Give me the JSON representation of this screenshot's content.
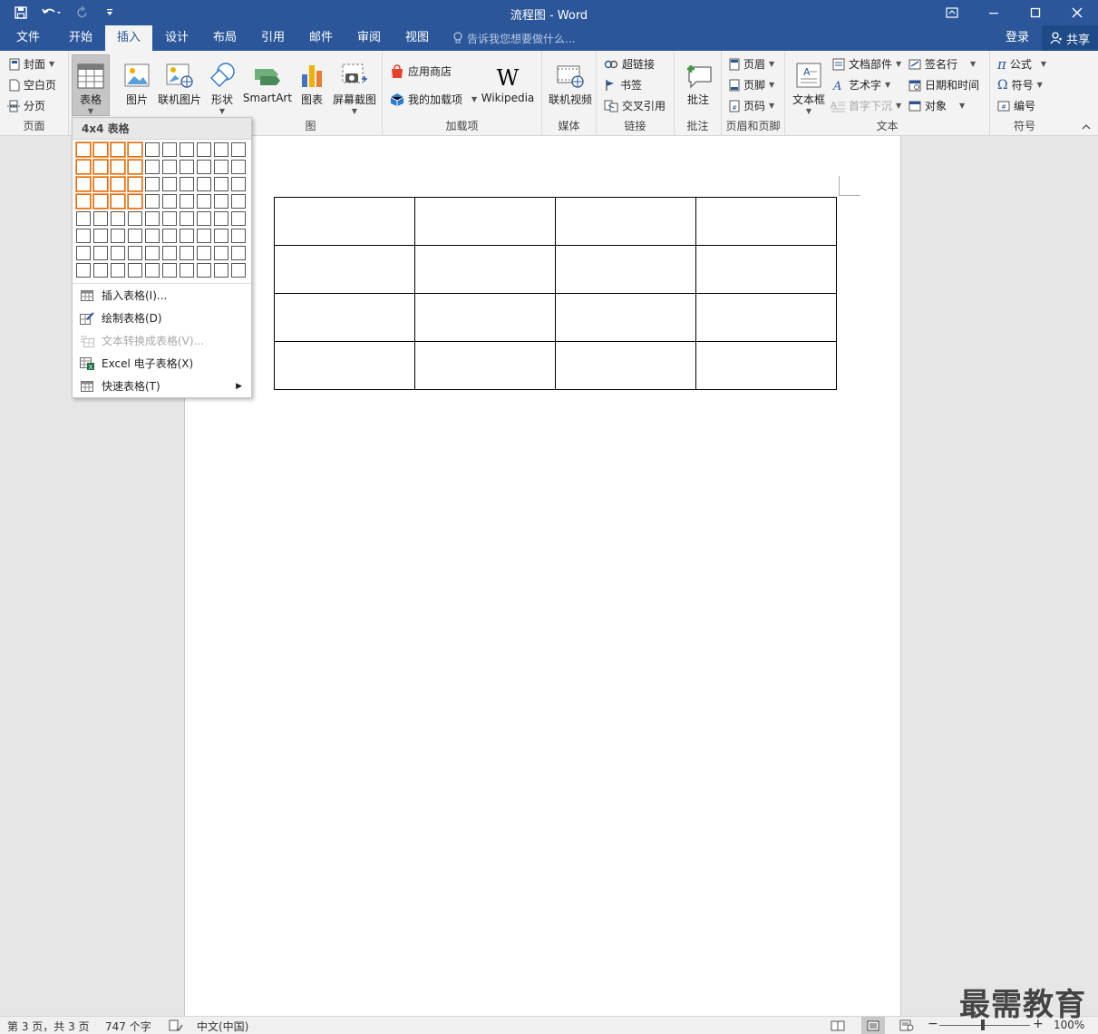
{
  "window": {
    "title": "流程图 - Word"
  },
  "tabs": [
    "文件",
    "开始",
    "插入",
    "设计",
    "布局",
    "引用",
    "邮件",
    "审阅",
    "视图"
  ],
  "active_tab": "插入",
  "tell_me": "告诉我您想要做什么...",
  "login": "登录",
  "share": "共享",
  "ribbon": {
    "pages": {
      "label": "页面",
      "cover": "封面",
      "blank": "空白页",
      "break": "分页"
    },
    "tables": {
      "table": "表格"
    },
    "illustrations": {
      "picture": "图片",
      "online_picture": "联机图片",
      "shapes": "形状",
      "smartart": "SmartArt",
      "chart": "图表",
      "screenshot": "屏幕截图",
      "label_tail": "图"
    },
    "addins": {
      "label": "加载项",
      "store": "应用商店",
      "my_addins": "我的加载项",
      "wikipedia": "Wikipedia"
    },
    "media": {
      "label": "媒体",
      "online_video": "联机视频"
    },
    "links": {
      "label": "链接",
      "hyperlink": "超链接",
      "bookmark": "书签",
      "crossref": "交叉引用"
    },
    "comments": {
      "label": "批注",
      "comment": "批注"
    },
    "header_footer": {
      "label": "页眉和页脚",
      "header": "页眉",
      "footer": "页脚",
      "page_number": "页码"
    },
    "text": {
      "label": "文本",
      "textbox": "文本框",
      "quickparts": "文档部件",
      "wordart": "艺术字",
      "dropcap": "首字下沉",
      "signature": "签名行",
      "datetime": "日期和时间",
      "object": "对象"
    },
    "symbols": {
      "label": "符号",
      "equation": "公式",
      "symbol": "符号",
      "number": "编号"
    }
  },
  "table_menu": {
    "header": "4x4 表格",
    "grid": {
      "cols": 10,
      "rows": 8,
      "selected_cols": 4,
      "selected_rows": 4
    },
    "items": [
      {
        "label": "插入表格(I)...",
        "enabled": true
      },
      {
        "label": "绘制表格(D)",
        "enabled": true
      },
      {
        "label": "文本转换成表格(V)...",
        "enabled": false
      },
      {
        "label": "Excel 电子表格(X)",
        "enabled": true
      },
      {
        "label": "快速表格(T)",
        "enabled": true
      }
    ]
  },
  "document": {
    "table": {
      "rows": 4,
      "cols": 4
    }
  },
  "status": {
    "page": "第 3 页，共 3 页",
    "words": "747 个字",
    "language": "中文(中国)",
    "zoom": "100%"
  },
  "watermark": "最需教育"
}
